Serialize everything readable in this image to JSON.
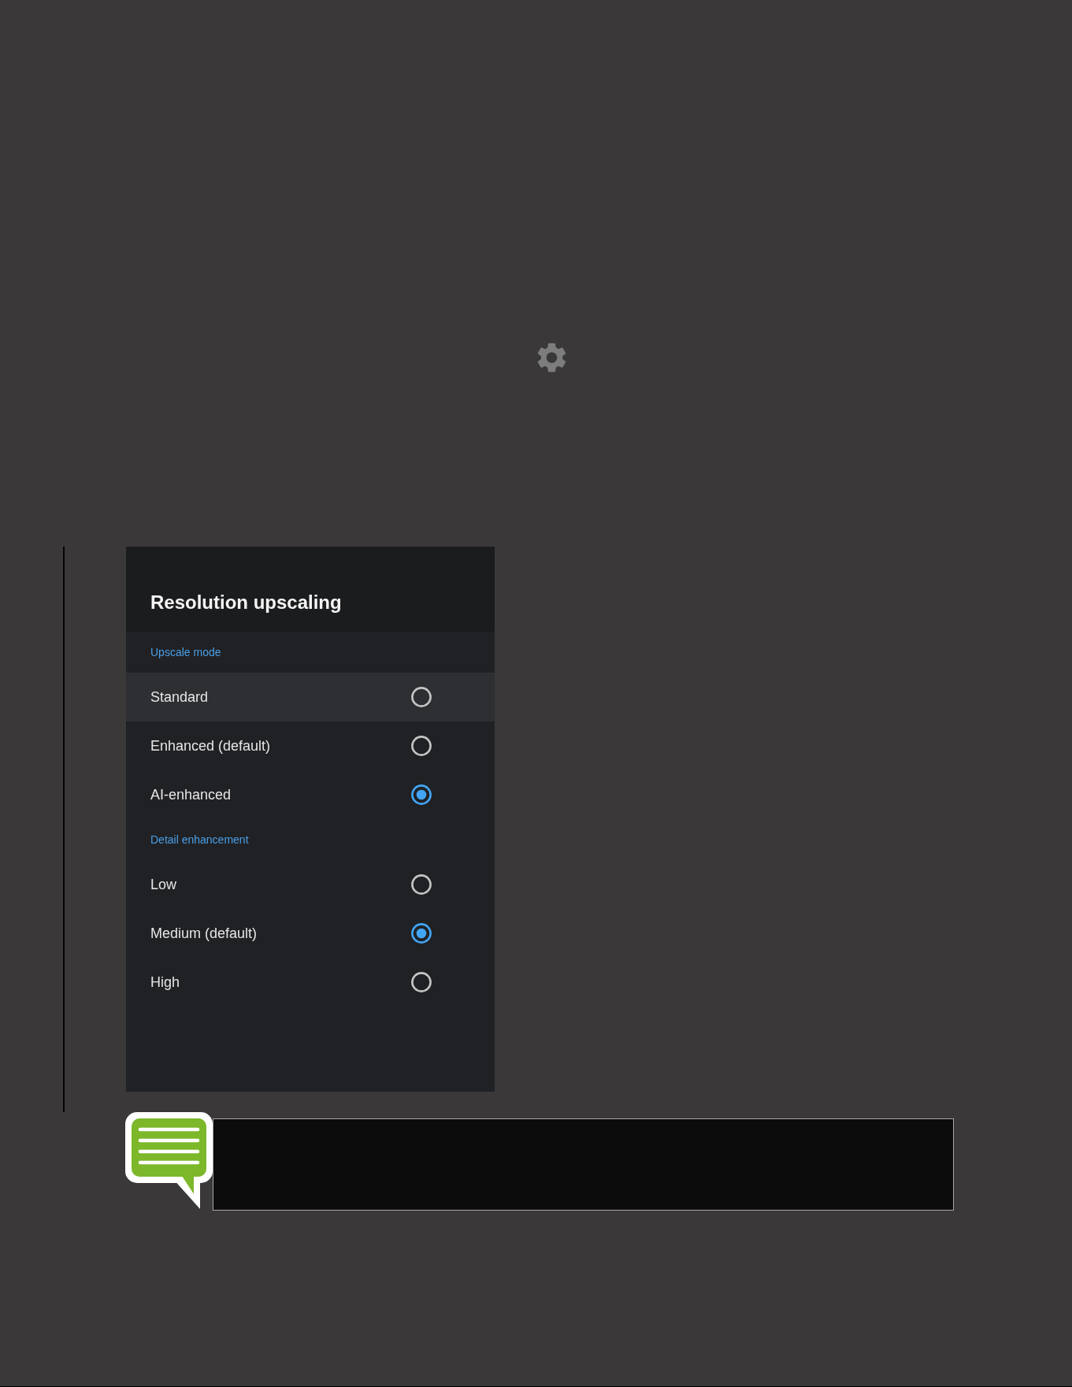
{
  "panel": {
    "title": "Resolution upscaling",
    "sections": [
      {
        "heading": "Upscale mode",
        "options": [
          {
            "label": "Standard",
            "selected": false,
            "focused": true
          },
          {
            "label": "Enhanced (default)",
            "selected": false,
            "focused": false
          },
          {
            "label": "AI-enhanced",
            "selected": true,
            "focused": false
          }
        ]
      },
      {
        "heading": "Detail enhancement",
        "options": [
          {
            "label": "Low",
            "selected": false,
            "focused": false
          },
          {
            "label": "Medium (default)",
            "selected": true,
            "focused": false
          },
          {
            "label": "High",
            "selected": false,
            "focused": false
          }
        ]
      }
    ]
  }
}
